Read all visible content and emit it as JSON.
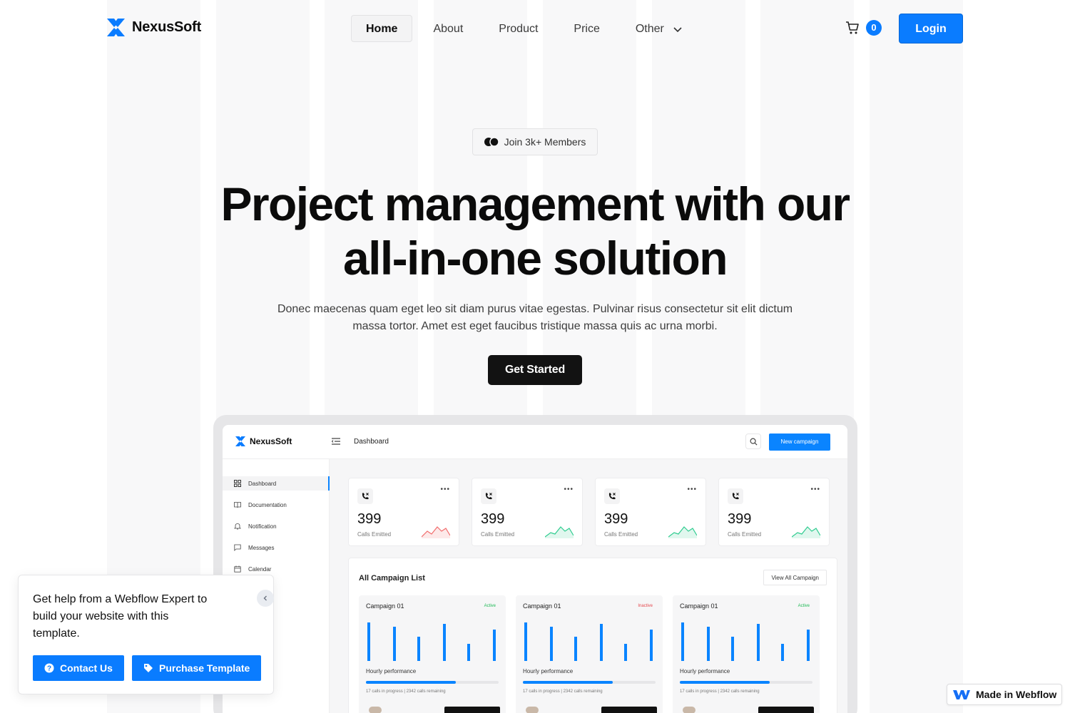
{
  "brand": {
    "name": "NexusSoft",
    "accent": "#0a7cff"
  },
  "nav": {
    "items": [
      {
        "label": "Home",
        "active": true
      },
      {
        "label": "About"
      },
      {
        "label": "Product"
      },
      {
        "label": "Price"
      },
      {
        "label": "Other",
        "dropdown": true
      }
    ],
    "cart_count": "0",
    "login_label": "Login"
  },
  "hero": {
    "badge": "Join 3k+ Members",
    "title": "Project management with our all-in-one solution",
    "description": "Donec maecenas quam eget leo sit diam purus vitae egestas. Pulvinar risus consectetur sit elit dictum massa tortor. Amet est eget faucibus tristique massa quis ac urna morbi.",
    "cta": "Get Started"
  },
  "dashboard": {
    "brand": "NexusSoft",
    "crumb": "Dashboard",
    "new_campaign": "New campaign",
    "sidebar": [
      {
        "label": "Dashboard",
        "icon": "grid-icon",
        "active": true
      },
      {
        "label": "Documentation",
        "icon": "book-icon"
      },
      {
        "label": "Notification",
        "icon": "bell-icon"
      },
      {
        "label": "Messages",
        "icon": "message-icon"
      },
      {
        "label": "Calendar",
        "icon": "calendar-icon"
      }
    ],
    "stats": [
      {
        "value": "399",
        "label": "Calls Emitted",
        "trend_color": "#f26b6b"
      },
      {
        "value": "399",
        "label": "Calls Emitted",
        "trend_color": "#2ecc8f"
      },
      {
        "value": "399",
        "label": "Calls Emitted",
        "trend_color": "#2ecc8f"
      },
      {
        "value": "399",
        "label": "Calls Emitted",
        "trend_color": "#2ecc8f"
      }
    ],
    "campaign_list_title": "All Campaign List",
    "view_all": "View All Campaign",
    "campaigns": [
      {
        "name": "Campaign 01",
        "status": "Active",
        "perf_label": "Hourly performance",
        "progress": 0.68,
        "note": "17 calls in progress | 2342 calls remaining"
      },
      {
        "name": "Campaign 01",
        "status": "Inactive",
        "perf_label": "Hourly performance",
        "progress": 0.68,
        "note": "17 calls in progress | 2342 calls remaining"
      },
      {
        "name": "Campaign 01",
        "status": "Active",
        "perf_label": "Hourly performance",
        "progress": 0.68,
        "note": "17 calls in progress | 2342 calls remaining"
      }
    ]
  },
  "help": {
    "text": "Get help from a Webflow Expert to build your website with this template.",
    "contact_label": "Contact Us",
    "purchase_label": "Purchase Template"
  },
  "webflow_badge": "Made in Webflow"
}
